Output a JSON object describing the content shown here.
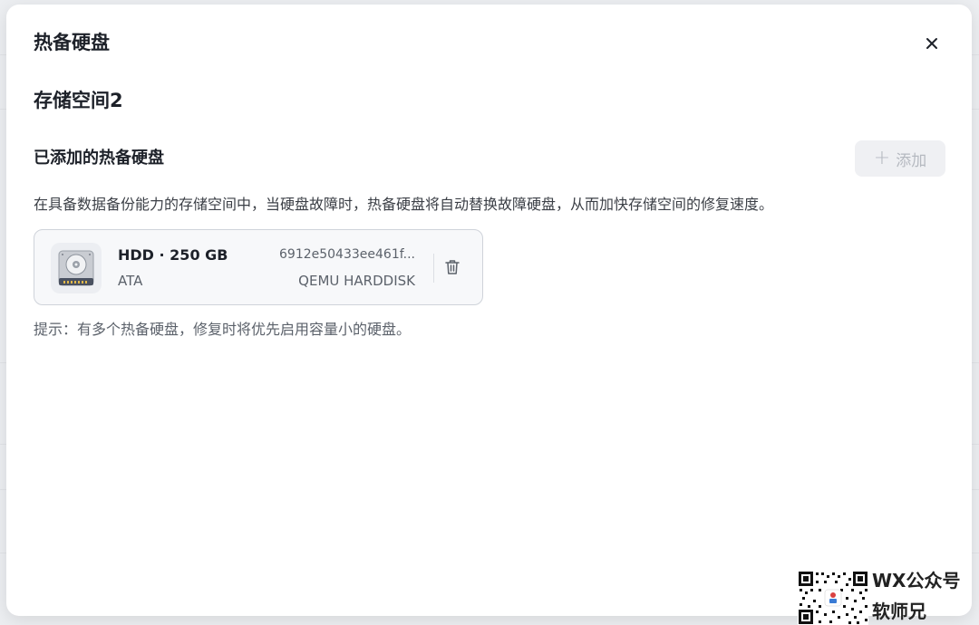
{
  "dialog": {
    "title": "热备硬盘",
    "close_icon": "close-icon"
  },
  "pool": {
    "name": "存储空间2"
  },
  "section": {
    "title": "已添加的热备硬盘",
    "add_button_label": "添加",
    "add_button_icon": "plus-icon",
    "add_button_state": "disabled",
    "description": "在具备数据备份能力的存储空间中，当硬盘故障时，热备硬盘将自动替换故障硬盘，从而加快存储空间的修复速度。"
  },
  "disks": [
    {
      "icon": "hard-disk-icon",
      "type_capacity": "HDD · 250 GB",
      "interface": "ATA",
      "serial": "6912e50433ee461f...",
      "model": "QEMU HARDDISK",
      "delete_icon": "trash-icon"
    }
  ],
  "hint": "提示：有多个热备硬盘，修复时将优先启用容量小的硬盘。",
  "watermark": {
    "line1": "WX公众号",
    "line2": "软师兄"
  },
  "colors": {
    "primary_text": "#1d2129",
    "secondary_text": "#5c626b",
    "card_border": "#cfd3da",
    "disabled_button_bg": "#eff0f3",
    "disabled_button_text": "#b5b9c0"
  }
}
